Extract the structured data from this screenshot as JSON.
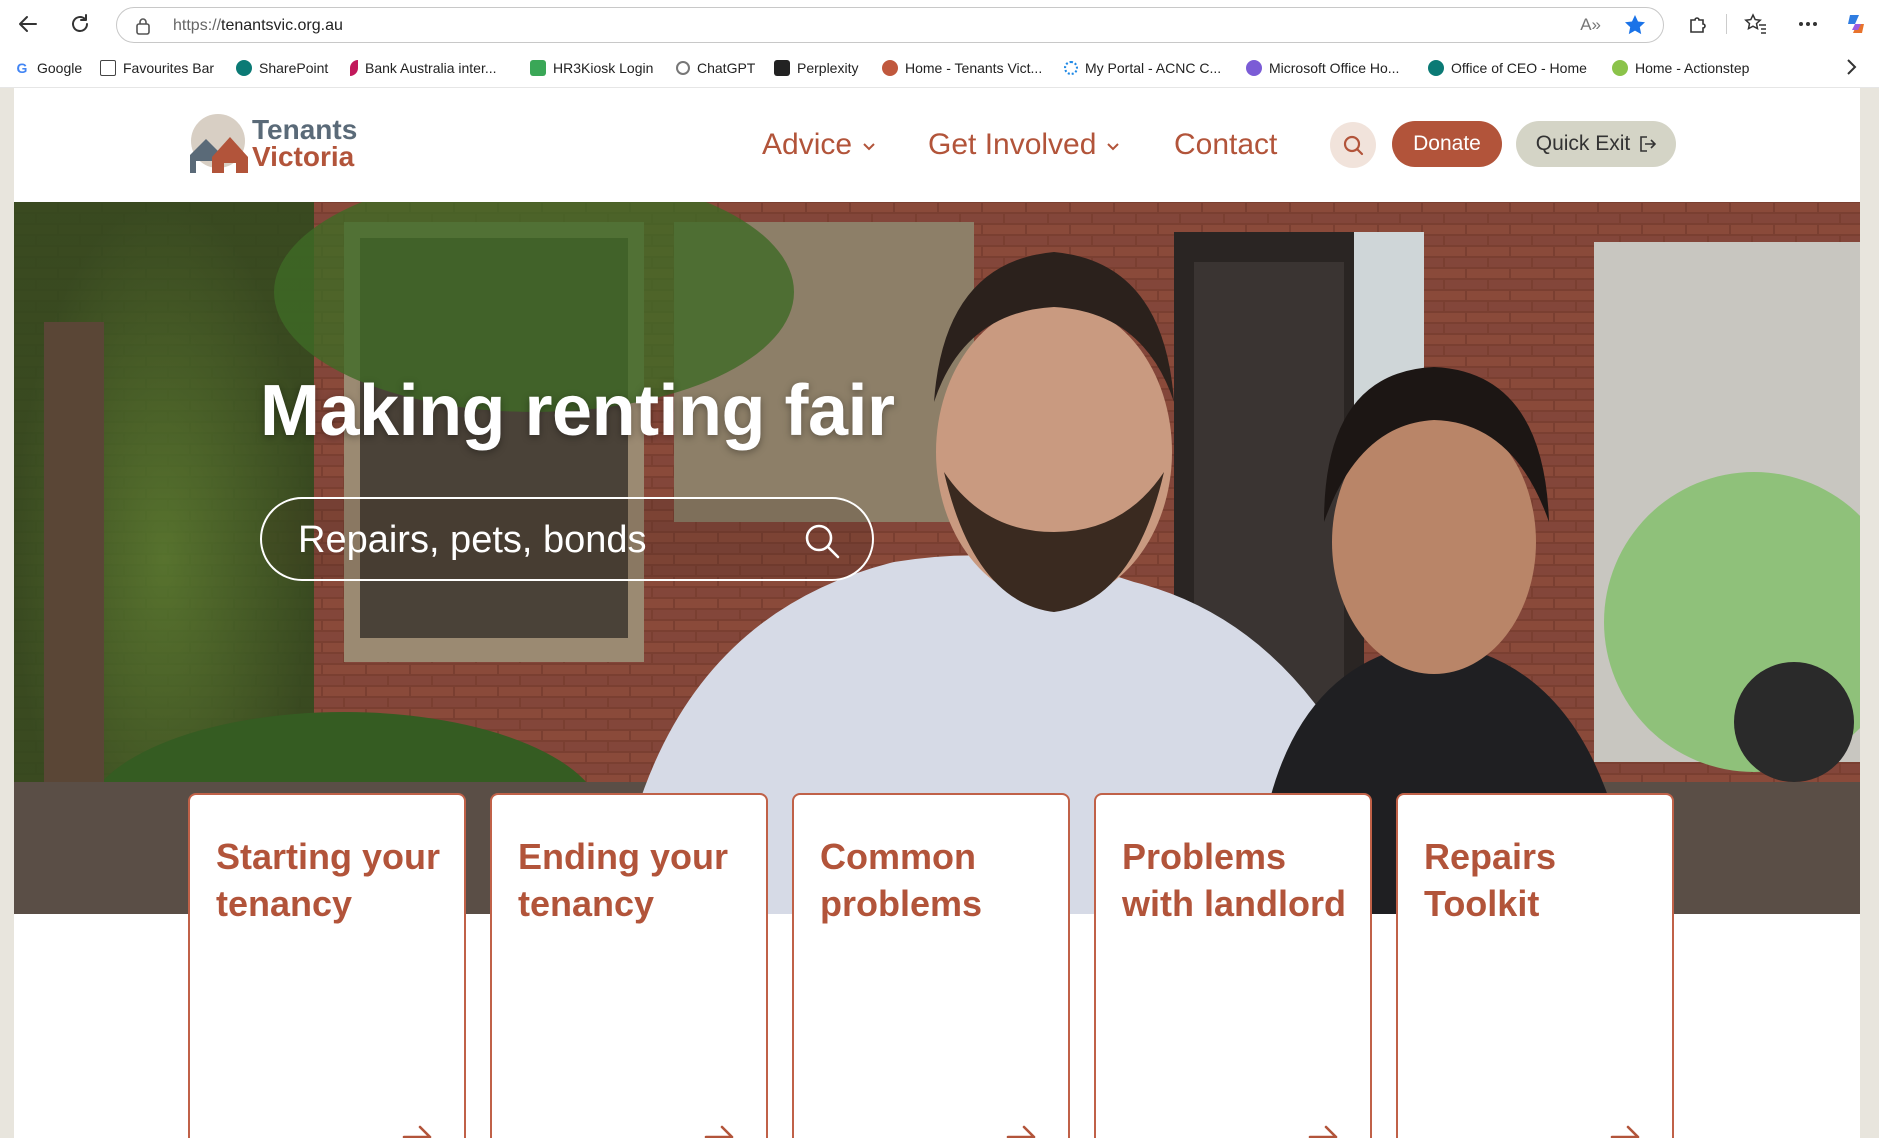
{
  "browser": {
    "url_protocol": "https://",
    "url_host": "tenantsvic.org.au",
    "read_aloud_label": "A»",
    "bookmarks": [
      {
        "label": "Google",
        "icon": "google-icon",
        "color": "#4285f4"
      },
      {
        "label": "Favourites Bar",
        "icon": "folder-icon",
        "color": "#ffffff"
      },
      {
        "label": "SharePoint",
        "icon": "sharepoint-icon",
        "color": "#0b7a75"
      },
      {
        "label": "Bank Australia inter...",
        "icon": "bank-australia-icon",
        "color": "#c2185b"
      },
      {
        "label": "HR3Kiosk Login",
        "icon": "hr3kiosk-icon",
        "color": "#3aa757"
      },
      {
        "label": "ChatGPT",
        "icon": "chatgpt-icon",
        "color": "#666666"
      },
      {
        "label": "Perplexity",
        "icon": "perplexity-icon",
        "color": "#222222"
      },
      {
        "label": "Home - Tenants Vict...",
        "icon": "tenants-vic-icon",
        "color": "#c0583d"
      },
      {
        "label": "My Portal - ACNC C...",
        "icon": "acnc-icon",
        "color": "#1e88e5"
      },
      {
        "label": "Microsoft Office Ho...",
        "icon": "office-icon",
        "color": "#7b5cd6"
      },
      {
        "label": "Office of CEO - Home",
        "icon": "sharepoint-icon",
        "color": "#0b7a75"
      },
      {
        "label": "Home - Actionstep",
        "icon": "actionstep-icon",
        "color": "#8bc34a"
      }
    ]
  },
  "site": {
    "logo": {
      "line1": "Tenants",
      "line2": "Victoria"
    },
    "nav": {
      "advice": "Advice",
      "get_involved": "Get Involved",
      "contact": "Contact"
    },
    "donate_label": "Donate",
    "quick_exit_label": "Quick Exit",
    "brand_color": "#b2543a"
  },
  "hero": {
    "title": "Making renting fair",
    "search_placeholder": "Repairs, pets, bonds"
  },
  "cards": [
    {
      "title": "Starting your tenancy"
    },
    {
      "title": "Ending your tenancy"
    },
    {
      "title": "Common problems"
    },
    {
      "title": "Problems with landlord"
    },
    {
      "title": "Repairs Toolkit"
    }
  ]
}
